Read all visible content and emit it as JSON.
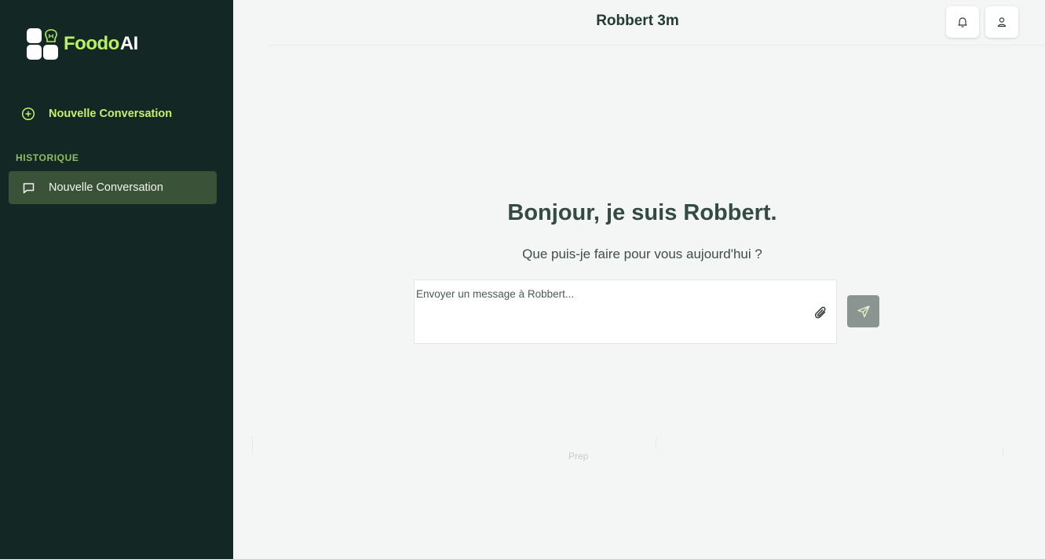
{
  "sidebar": {
    "logo": {
      "brand": "Foodo",
      "suffix": "AI"
    },
    "new_conversation_label": "Nouvelle Conversation",
    "history_label": "HISTORIQUE",
    "history_items": [
      {
        "label": "Nouvelle Conversation",
        "active": true
      }
    ]
  },
  "header": {
    "title": "Robbert 3m",
    "icons": [
      "bell-icon",
      "user-icon"
    ]
  },
  "main": {
    "greeting": "Bonjour, je suis Robbert.",
    "subtitle": "Que puis-je faire pour vous aujourd'hui ?",
    "input": {
      "placeholder": "Envoyer un message à Robbert...",
      "value": ""
    },
    "faint_text": "Prep"
  },
  "colors": {
    "sidebar_bg": "#132725",
    "accent": "#b9f25a",
    "active_item_bg": "#3a5238",
    "send_button_bg": "#8a9591"
  }
}
